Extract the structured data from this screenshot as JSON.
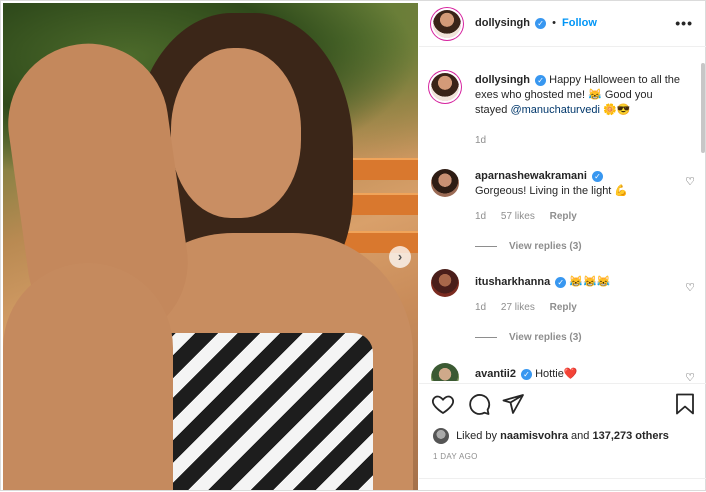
{
  "post": {
    "username": "dollysingh",
    "follow_label": "Follow",
    "separator": "•",
    "more_label": "•••",
    "next_label": "›"
  },
  "caption": {
    "username": "dollysingh",
    "text_1": "Happy Halloween to all the exes who ghosted me! 😹 Good you stayed ",
    "mention": "@manuchaturvedi",
    "text_2": " 🌼😎",
    "time": "1d"
  },
  "comments": [
    {
      "username": "aparnashewakramani",
      "text": "Gorgeous! Living in the light 💪",
      "time": "1d",
      "likes": "57 likes",
      "reply": "Reply",
      "view_replies": "View replies (3)"
    },
    {
      "username": "itusharkhanna",
      "text": "😹😹😹",
      "time": "1d",
      "likes": "27 likes",
      "reply": "Reply",
      "view_replies": "View replies (3)"
    },
    {
      "username": "avantii2",
      "text": "Hottie❤️"
    }
  ],
  "actions": {
    "liked_by_prefix": "Liked by",
    "liked_by_user": "naamisvohra",
    "liked_by_mid": "and",
    "liked_by_count": "137,273 others",
    "time_ago": "1 DAY AGO"
  },
  "icons": {
    "heart": "heart-icon",
    "comment": "comment-icon",
    "share": "paper-plane-icon",
    "save": "bookmark-icon",
    "verified": "verified-badge-icon"
  },
  "colors": {
    "link": "#0095f6",
    "verified": "#3897f0",
    "secondary_text": "#8e8e8e"
  }
}
